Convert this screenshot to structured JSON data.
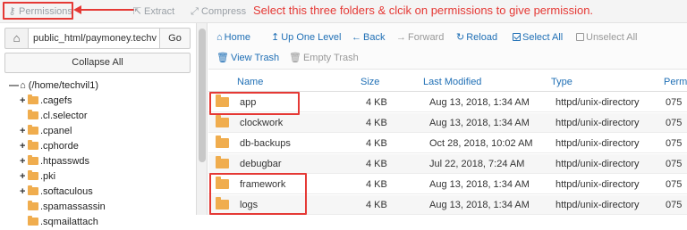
{
  "toolbar": {
    "permissions": "Permissions",
    "extract": "Extract",
    "compress": "Compress",
    "annotation": "Select this three folders & clcik on permissions to give permission."
  },
  "left": {
    "path_value": "public_html/paymoney.techv",
    "go": "Go",
    "collapse_all": "Collapse All",
    "tree": [
      {
        "toggle": "—",
        "label": "(/home/techvil1)",
        "root": true
      },
      {
        "toggle": "+",
        "label": ".cagefs"
      },
      {
        "toggle": "",
        "label": ".cl.selector"
      },
      {
        "toggle": "+",
        "label": ".cpanel"
      },
      {
        "toggle": "+",
        "label": ".cphorde"
      },
      {
        "toggle": "+",
        "label": ".htpasswds"
      },
      {
        "toggle": "+",
        "label": ".pki"
      },
      {
        "toggle": "+",
        "label": ".softaculous"
      },
      {
        "toggle": "",
        "label": ".spamassassin"
      },
      {
        "toggle": "",
        "label": ".sqmailattach"
      }
    ]
  },
  "actions": {
    "home": "Home",
    "up_one_level": "Up One Level",
    "back": "Back",
    "forward": "Forward",
    "reload": "Reload",
    "select_all": "Select All",
    "unselect_all": "Unselect All",
    "view_trash": "View Trash",
    "empty_trash": "Empty Trash"
  },
  "table": {
    "headers": {
      "name": "Name",
      "size": "Size",
      "modified": "Last Modified",
      "type": "Type",
      "perms": "Perm"
    },
    "rows": [
      {
        "name": "app",
        "size": "4 KB",
        "modified": "Aug 13, 2018, 1:34 AM",
        "type": "httpd/unix-directory",
        "perms": "075"
      },
      {
        "name": "clockwork",
        "size": "4 KB",
        "modified": "Aug 13, 2018, 1:34 AM",
        "type": "httpd/unix-directory",
        "perms": "075"
      },
      {
        "name": "db-backups",
        "size": "4 KB",
        "modified": "Oct 28, 2018, 10:02 AM",
        "type": "httpd/unix-directory",
        "perms": "075"
      },
      {
        "name": "debugbar",
        "size": "4 KB",
        "modified": "Jul 22, 2018, 7:24 AM",
        "type": "httpd/unix-directory",
        "perms": "075"
      },
      {
        "name": "framework",
        "size": "4 KB",
        "modified": "Aug 13, 2018, 1:34 AM",
        "type": "httpd/unix-directory",
        "perms": "075"
      },
      {
        "name": "logs",
        "size": "4 KB",
        "modified": "Aug 13, 2018, 1:34 AM",
        "type": "httpd/unix-directory",
        "perms": "075"
      }
    ]
  },
  "colors": {
    "accent": "#1f6fb5",
    "annotation": "#e53935",
    "folder": "#f0ad4e"
  }
}
